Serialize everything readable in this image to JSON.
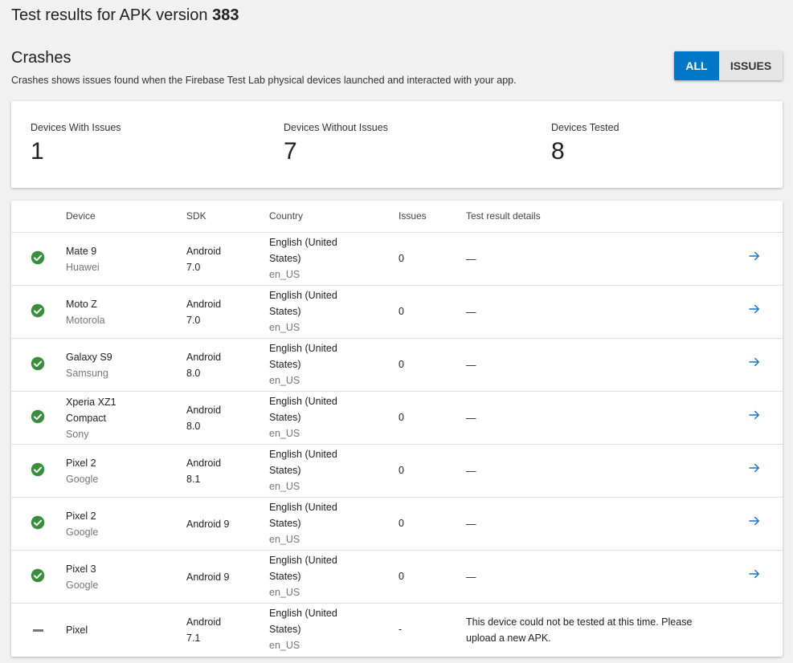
{
  "header": {
    "title_prefix": "Test results for APK version ",
    "version": "383"
  },
  "section": {
    "title": "Crashes",
    "description": "Crashes shows issues found when the Firebase Test Lab physical devices launched and interacted with your app."
  },
  "filter": {
    "all_label": "ALL",
    "issues_label": "ISSUES",
    "selected": "ALL"
  },
  "summary": {
    "with_issues_label": "Devices With Issues",
    "with_issues_value": "1",
    "without_issues_label": "Devices Without Issues",
    "without_issues_value": "7",
    "tested_label": "Devices Tested",
    "tested_value": "8"
  },
  "table": {
    "columns": [
      "Device",
      "SDK",
      "Country",
      "Issues",
      "Test result details"
    ],
    "rows": [
      {
        "status": "check-circle-icon",
        "device": "Mate 9",
        "maker": "Huawei",
        "sdk": "Android 7.0",
        "country": "English (United States)",
        "locale": "en_US",
        "issues": "0",
        "details": "—"
      },
      {
        "status": "check-circle-icon",
        "device": "Moto Z",
        "maker": "Motorola",
        "sdk": "Android 7.0",
        "country": "English (United States)",
        "locale": "en_US",
        "issues": "0",
        "details": "—"
      },
      {
        "status": "check-circle-icon",
        "device": "Galaxy S9",
        "maker": "Samsung",
        "sdk": "Android 8.0",
        "country": "English (United States)",
        "locale": "en_US",
        "issues": "0",
        "details": "—"
      },
      {
        "status": "check-circle-icon",
        "device": "Xperia XZ1 Compact",
        "maker": "Sony",
        "sdk": "Android 8.0",
        "country": "English (United States)",
        "locale": "en_US",
        "issues": "0",
        "details": "—"
      },
      {
        "status": "check-circle-icon",
        "device": "Pixel 2",
        "maker": "Google",
        "sdk": "Android 8.1",
        "country": "English (United States)",
        "locale": "en_US",
        "issues": "0",
        "details": "—"
      },
      {
        "status": "check-circle-icon",
        "device": "Pixel 2",
        "maker": "Google",
        "sdk": "Android 9",
        "country": "English (United States)",
        "locale": "en_US",
        "issues": "0",
        "details": "—"
      },
      {
        "status": "check-circle-icon",
        "device": "Pixel 3",
        "maker": "Google",
        "sdk": "Android 9",
        "country": "English (United States)",
        "locale": "en_US",
        "issues": "0",
        "details": "—"
      },
      {
        "status": "dash-icon",
        "device": "Pixel",
        "maker": "",
        "sdk": "Android 7.1",
        "country": "English (United States)",
        "locale": "en_US",
        "issues": "-",
        "details": "This device could not be tested at this time. Please upload a new APK."
      }
    ]
  },
  "colors": {
    "accent": "#0277c8",
    "success": "#388e3c",
    "arrow": "#1976d2"
  }
}
